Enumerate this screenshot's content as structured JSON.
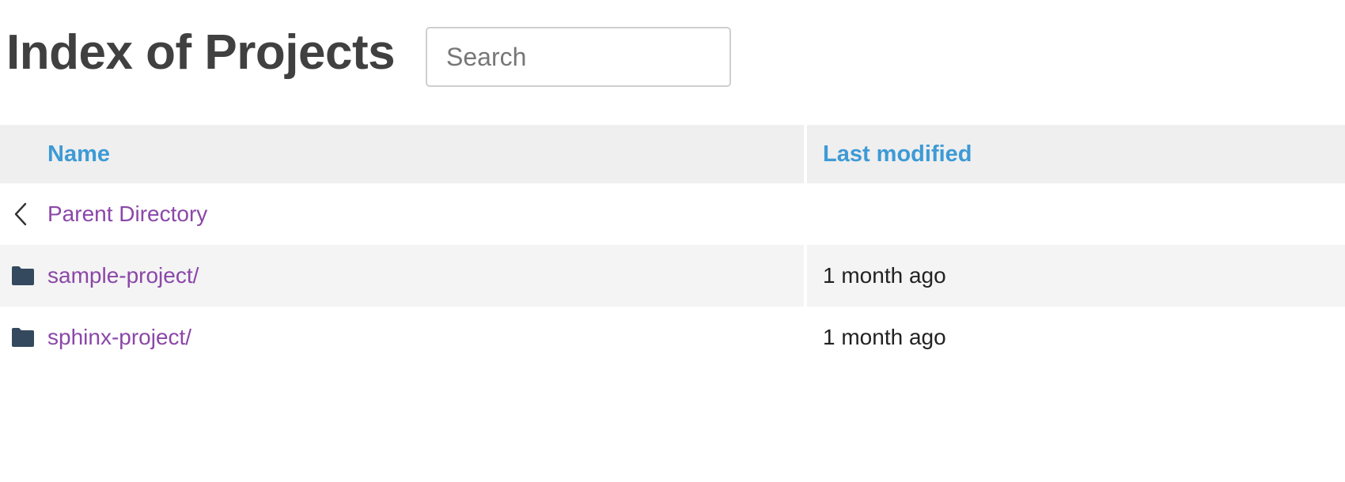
{
  "header": {
    "title": "Index of Projects",
    "search_placeholder": "Search"
  },
  "table": {
    "columns": {
      "name": "Name",
      "last_modified": "Last modified"
    },
    "parent": {
      "label": "Parent Directory",
      "icon": "chevron-left-icon"
    },
    "rows": [
      {
        "name": "sample-project/",
        "modified": "1 month ago",
        "icon": "folder-icon"
      },
      {
        "name": "sphinx-project/",
        "modified": "1 month ago",
        "icon": "folder-icon"
      }
    ]
  },
  "colors": {
    "title": "#404040",
    "header_link": "#3d9ad6",
    "entry_link": "#8b47a8",
    "folder_icon": "#34495e",
    "header_bg": "#efefef",
    "stripe_bg": "#f4f4f4"
  }
}
